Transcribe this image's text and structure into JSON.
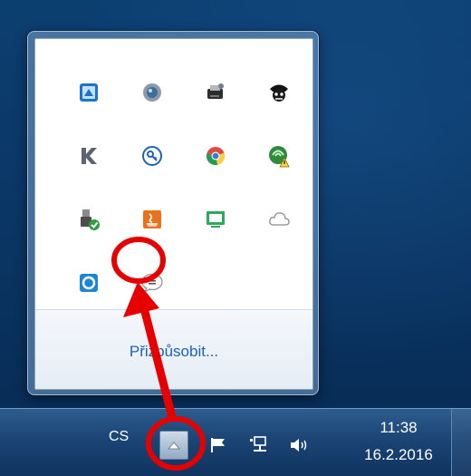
{
  "popup": {
    "icons": [
      {
        "name": "remote-desktop-icon"
      },
      {
        "name": "webcam-icon"
      },
      {
        "name": "printer-icon"
      },
      {
        "name": "pirate-icon"
      },
      {
        "name": "k-app-icon"
      },
      {
        "name": "key-icon"
      },
      {
        "name": "chrome-icon"
      },
      {
        "name": "network-warning-icon"
      },
      {
        "name": "usb-safe-remove-icon"
      },
      {
        "name": "java-icon"
      },
      {
        "name": "display-icon"
      },
      {
        "name": "cloud-icon"
      },
      {
        "name": "sync-icon"
      },
      {
        "name": "chat-bubble-icon"
      }
    ],
    "customize_label": "Přizpůsobit..."
  },
  "taskbar": {
    "language": "CS",
    "clock_time": "11:38",
    "clock_date": "16.2.2016"
  },
  "colors": {
    "annotation": "#e60000",
    "link": "#1a62c0"
  }
}
